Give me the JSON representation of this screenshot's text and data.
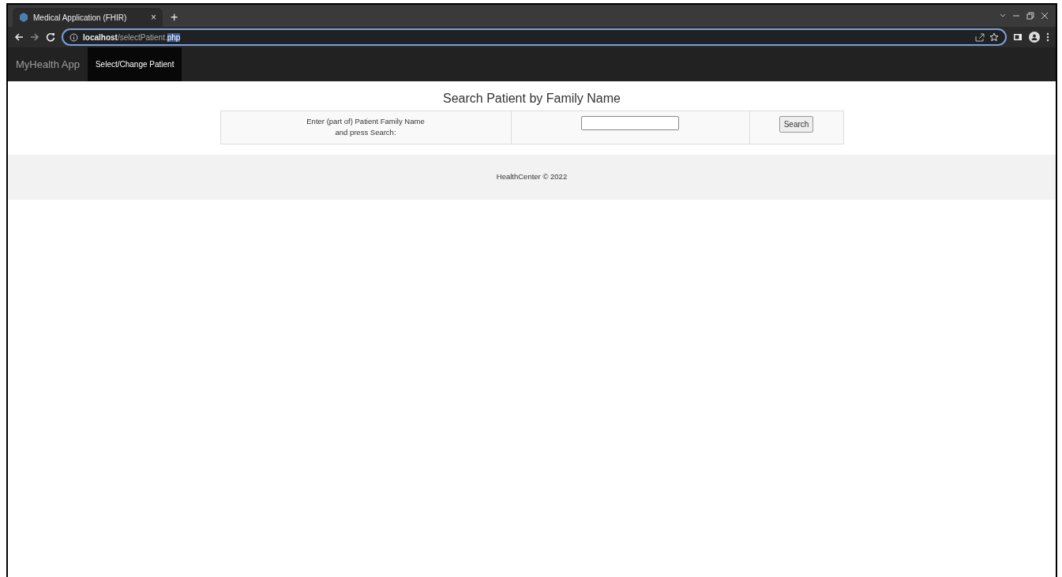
{
  "browser": {
    "tab": {
      "title": "Medical Application (FHIR)",
      "close": "×",
      "selected": true
    },
    "new_tab": "+",
    "url": {
      "host": "localhost",
      "path": "/selectPatient.",
      "selected_part": "php"
    }
  },
  "navbar": {
    "brand": "MyHealth App",
    "items": [
      {
        "label": "Select/Change Patient",
        "selected": true
      }
    ]
  },
  "search": {
    "title": "Search Patient by Family Name",
    "instructions": [
      "Enter (part of) Patient Family Name",
      "and press Search:"
    ],
    "button": "Search"
  },
  "footer": "HealthCenter © 2022"
}
